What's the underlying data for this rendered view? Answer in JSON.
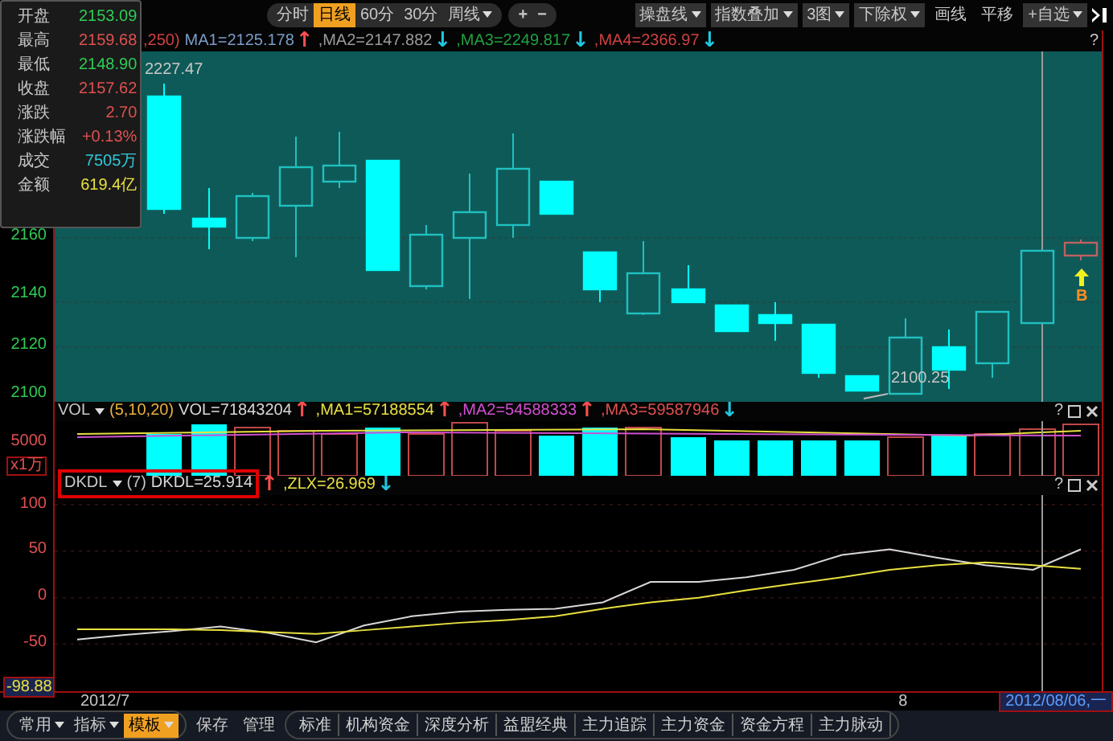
{
  "toolbar": {
    "period_tabs": [
      {
        "label": "分时",
        "selected": false,
        "dropdown": false
      },
      {
        "label": "日线",
        "selected": true,
        "dropdown": false
      },
      {
        "label": "60分",
        "selected": false,
        "dropdown": false
      },
      {
        "label": "30分",
        "selected": false,
        "dropdown": false
      },
      {
        "label": "周线",
        "selected": false,
        "dropdown": true
      }
    ],
    "zoom_buttons": [
      "+",
      "−"
    ],
    "tools": [
      {
        "label": "操盘线",
        "dropdown": true
      },
      {
        "label": "指数叠加",
        "dropdown": true
      },
      {
        "label": "3图",
        "dropdown": true
      },
      {
        "label": "下除权",
        "dropdown": true
      },
      {
        "label": "画线",
        "dropdown": false
      },
      {
        "label": "平移",
        "dropdown": false
      },
      {
        "label": "+自选",
        "dropdown": true
      }
    ]
  },
  "quote_panel": {
    "rows": [
      {
        "label": "开盘",
        "value": "2153.09",
        "color": "#2ecc55"
      },
      {
        "label": "最高",
        "value": "2159.68",
        "color": "#e05050"
      },
      {
        "label": "最低",
        "value": "2148.90",
        "color": "#2ecc55"
      },
      {
        "label": "收盘",
        "value": "2157.62",
        "color": "#e05050"
      },
      {
        "label": "涨跌",
        "value": "2.70",
        "color": "#e05050"
      },
      {
        "label": "涨跌幅",
        "value": "+0.13%",
        "color": "#e05050"
      },
      {
        "label": "成交",
        "value": "7505万",
        "color": "#30c8d8"
      },
      {
        "label": "金额",
        "value": "619.4亿",
        "color": "#e8e040"
      }
    ]
  },
  "price_chart": {
    "indicator_prefix": ",250)",
    "moving_averages": [
      {
        "label": "MA1=2125.178",
        "color": "#7a9cc8",
        "arrow": {
          "symbol": "↑",
          "color": "#ff5050"
        }
      },
      {
        "label": ",MA2=2147.882",
        "color": "#9a9a9a",
        "arrow": {
          "symbol": "↓",
          "color": "#20c8e0"
        }
      },
      {
        "label": ",MA3=2249.817",
        "color": "#20a040",
        "arrow": {
          "symbol": "↓",
          "color": "#20c8e0"
        }
      },
      {
        "label": ",MA4=2366.97",
        "color": "#d04040",
        "arrow": {
          "symbol": "↓",
          "color": "#20c8e0"
        }
      }
    ],
    "help": "?",
    "axis_labels": [
      "2160",
      "2140",
      "2120",
      "2100"
    ],
    "high_label": "2227.47",
    "low_label": "2100.25",
    "signal": "B"
  },
  "volume_panel": {
    "name": "VOL",
    "params": "(5,10,20)",
    "help": "?",
    "readings": [
      {
        "label": "VOL=71843204",
        "color": "#d8d8d8",
        "arrow": {
          "symbol": "↑",
          "color": "#ff5050"
        }
      },
      {
        "label": ",MA1=57188554",
        "color": "#e8e040",
        "arrow": {
          "symbol": "↑",
          "color": "#ff5050"
        }
      },
      {
        "label": ",MA2=54588333",
        "color": "#d050d0",
        "arrow": {
          "symbol": "↑",
          "color": "#ff5050"
        }
      },
      {
        "label": ",MA3=59587946",
        "color": "#e05050",
        "arrow": {
          "symbol": "↓",
          "color": "#20c8e0"
        }
      }
    ],
    "axis_labels": [
      "5000"
    ],
    "unit": "x1万"
  },
  "dkdl_panel": {
    "name": "DKDL",
    "params": "(7)",
    "help": "?",
    "readings": [
      {
        "value": "=25.914",
        "arrow": {
          "symbol": "↑",
          "color": "#ff5050"
        }
      },
      {
        "separator": ",",
        "value": "=26.969",
        "arrow": {
          "symbol": "↓",
          "color": "#20c8e0"
        }
      }
    ],
    "min_label": "-98.88",
    "chart_data": {
      "type": "line",
      "ylim": [
        -98.88,
        100
      ],
      "yticks": [
        100,
        50,
        0,
        -50
      ],
      "grid": true,
      "series": [
        {
          "name": "DKDL",
          "color": "#d8d8d8",
          "values": [
            -45,
            -40,
            -36,
            -31,
            -38,
            -48,
            -30,
            -20,
            -15,
            -13,
            -12,
            -5,
            17,
            17,
            22,
            30,
            46,
            52,
            43,
            35,
            30,
            52
          ]
        },
        {
          "name": "ZLX",
          "color": "#e8e040",
          "values": [
            -34,
            -34,
            -34,
            -35,
            -37,
            -39,
            -35,
            -31,
            -27,
            -24,
            -20,
            -12,
            -5,
            0,
            8,
            15,
            22,
            30,
            35,
            38,
            35,
            31
          ]
        }
      ]
    }
  },
  "date_axis": {
    "labels": [
      "2012/7",
      "8"
    ],
    "cursor_date": "2012/08/06,一"
  },
  "bottom_bar": {
    "menus": [
      {
        "label": "常用",
        "selected": false
      },
      {
        "label": "指标",
        "selected": false
      },
      {
        "label": "模板",
        "selected": true
      }
    ],
    "actions": [
      "保存",
      "管理"
    ],
    "templates": [
      "标准",
      "机构资金",
      "深度分析",
      "益盟经典",
      "主力追踪",
      "主力资金",
      "资金方程",
      "主力脉动"
    ]
  }
}
